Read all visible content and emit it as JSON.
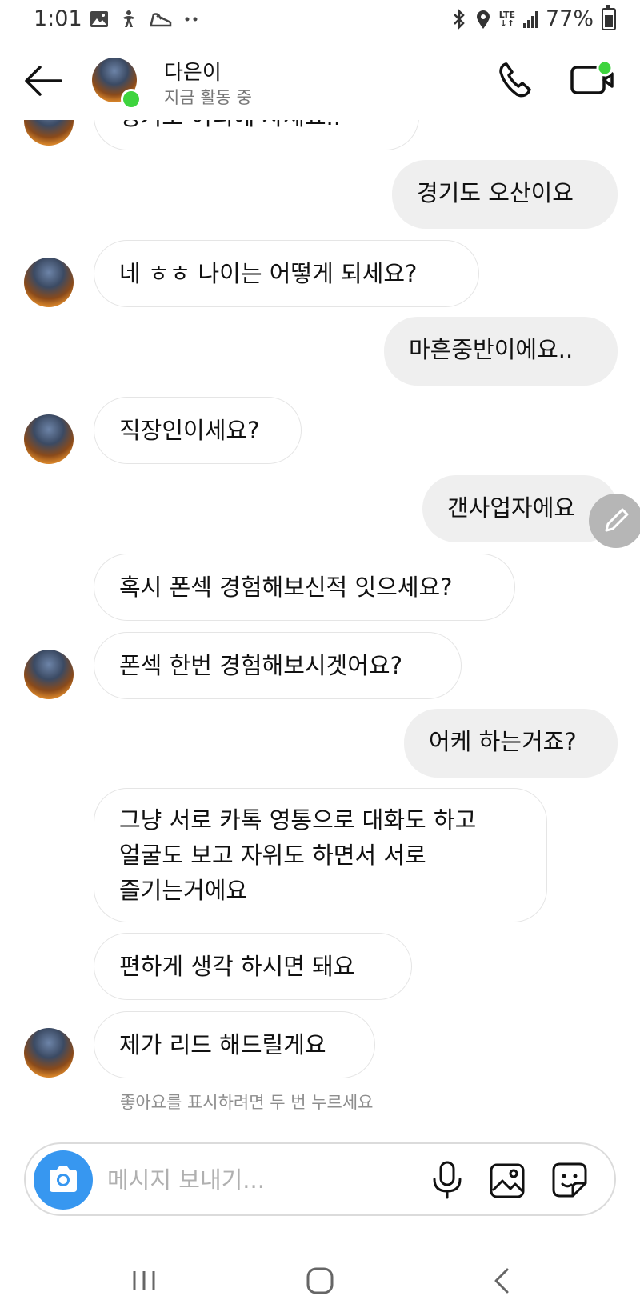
{
  "status_bar": {
    "time": "1:01",
    "battery": "77%",
    "network": "LTE",
    "icons": [
      "image-icon",
      "accessibility-icon",
      "sneaker-icon",
      "more-dots-icon",
      "bluetooth-icon",
      "location-icon",
      "lte-icon",
      "signal-icon",
      "battery-icon"
    ]
  },
  "header": {
    "contact_name": "다은이",
    "contact_status": "지금 활동 중",
    "online_color": "#3ed43e",
    "icons": [
      "back-arrow-icon",
      "phone-icon",
      "video-call-icon"
    ]
  },
  "messages": [
    {
      "side": "in",
      "text": "경기도 어디에 사세요..",
      "partially_visible": true
    },
    {
      "side": "out",
      "text": "경기도 오산이요"
    },
    {
      "side": "in",
      "text": "네 ㅎㅎ 나이는 어떻게 되세요?"
    },
    {
      "side": "out",
      "text": "마흔중반이에요.."
    },
    {
      "side": "in",
      "text": "직장인이세요?"
    },
    {
      "side": "out",
      "text": "갠사업자에요"
    },
    {
      "side": "in",
      "text": "혹시 폰섹 경험해보신적 잇으세요?"
    },
    {
      "side": "in",
      "text": "폰섹 한번 경험해보시겟어요?"
    },
    {
      "side": "out",
      "text": "어케 하는거죠?"
    },
    {
      "side": "in",
      "lines": [
        "그냥 서로 카톡 영통으로 대화도 하고",
        "얼굴도 보고 자위도 하면서 서로",
        "즐기는거에요"
      ]
    },
    {
      "side": "in",
      "text": "편하게  생각 하시면 돼요"
    },
    {
      "side": "in",
      "text": "제가 리드 해드릴게요"
    }
  ],
  "like_hint": "좋아요를 표시하려면 두 번 누르세요",
  "composer": {
    "placeholder": "메시지 보내기...",
    "value": "",
    "camera_color": "#3797f0"
  },
  "nav": {
    "icons": [
      "recents-icon",
      "home-icon",
      "back-icon"
    ]
  }
}
